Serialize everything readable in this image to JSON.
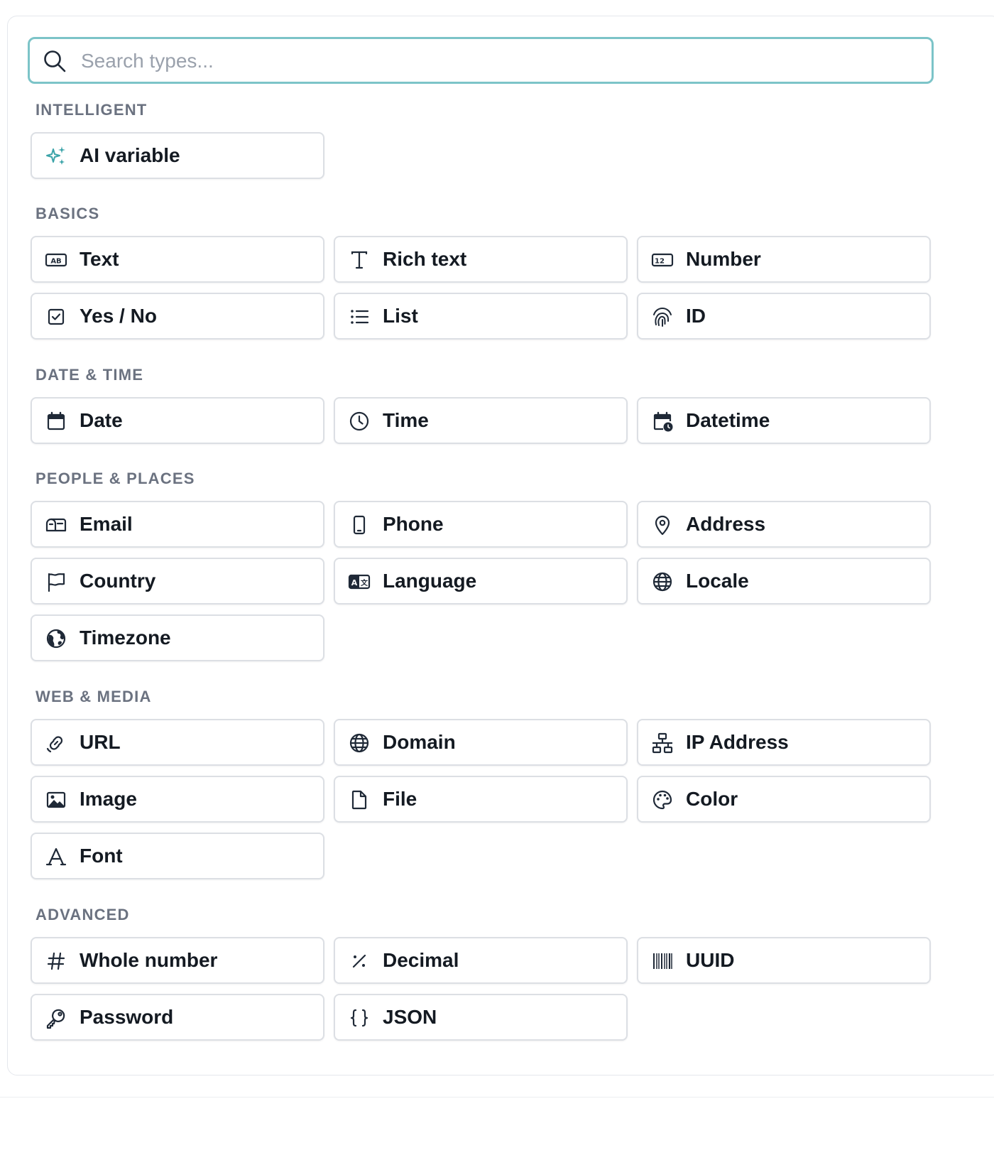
{
  "search": {
    "placeholder": "Search types...",
    "value": ""
  },
  "accent_color": "#7cc4c8",
  "sections": {
    "intelligent": {
      "title": "INTELLIGENT",
      "items": [
        {
          "label": "AI variable",
          "icon": "sparkles-icon"
        }
      ]
    },
    "basics": {
      "title": "BASICS",
      "items": [
        {
          "label": "Text",
          "icon": "text-ab-icon"
        },
        {
          "label": "Rich text",
          "icon": "rich-text-icon"
        },
        {
          "label": "Number",
          "icon": "number-icon"
        },
        {
          "label": "Yes / No",
          "icon": "checkbox-icon"
        },
        {
          "label": "List",
          "icon": "list-icon"
        },
        {
          "label": "ID",
          "icon": "fingerprint-icon"
        }
      ]
    },
    "datetime": {
      "title": "DATE & TIME",
      "items": [
        {
          "label": "Date",
          "icon": "calendar-icon"
        },
        {
          "label": "Time",
          "icon": "clock-icon"
        },
        {
          "label": "Datetime",
          "icon": "calendar-clock-icon"
        }
      ]
    },
    "people": {
      "title": "PEOPLE & PLACES",
      "items": [
        {
          "label": "Email",
          "icon": "mailbox-icon"
        },
        {
          "label": "Phone",
          "icon": "phone-icon"
        },
        {
          "label": "Address",
          "icon": "map-pin-icon"
        },
        {
          "label": "Country",
          "icon": "flag-icon"
        },
        {
          "label": "Language",
          "icon": "language-icon"
        },
        {
          "label": "Locale",
          "icon": "globe-icon"
        },
        {
          "label": "Timezone",
          "icon": "earth-icon"
        }
      ]
    },
    "web": {
      "title": "WEB & MEDIA",
      "items": [
        {
          "label": "URL",
          "icon": "link-icon"
        },
        {
          "label": "Domain",
          "icon": "globe-icon"
        },
        {
          "label": "IP Address",
          "icon": "network-icon"
        },
        {
          "label": "Image",
          "icon": "image-icon"
        },
        {
          "label": "File",
          "icon": "file-icon"
        },
        {
          "label": "Color",
          "icon": "palette-icon"
        },
        {
          "label": "Font",
          "icon": "font-icon"
        }
      ]
    },
    "advanced": {
      "title": "ADVANCED",
      "items": [
        {
          "label": "Whole number",
          "icon": "hash-icon"
        },
        {
          "label": "Decimal",
          "icon": "percent-icon"
        },
        {
          "label": "UUID",
          "icon": "barcode-icon"
        },
        {
          "label": "Password",
          "icon": "key-icon"
        },
        {
          "label": "JSON",
          "icon": "braces-icon"
        }
      ]
    }
  }
}
